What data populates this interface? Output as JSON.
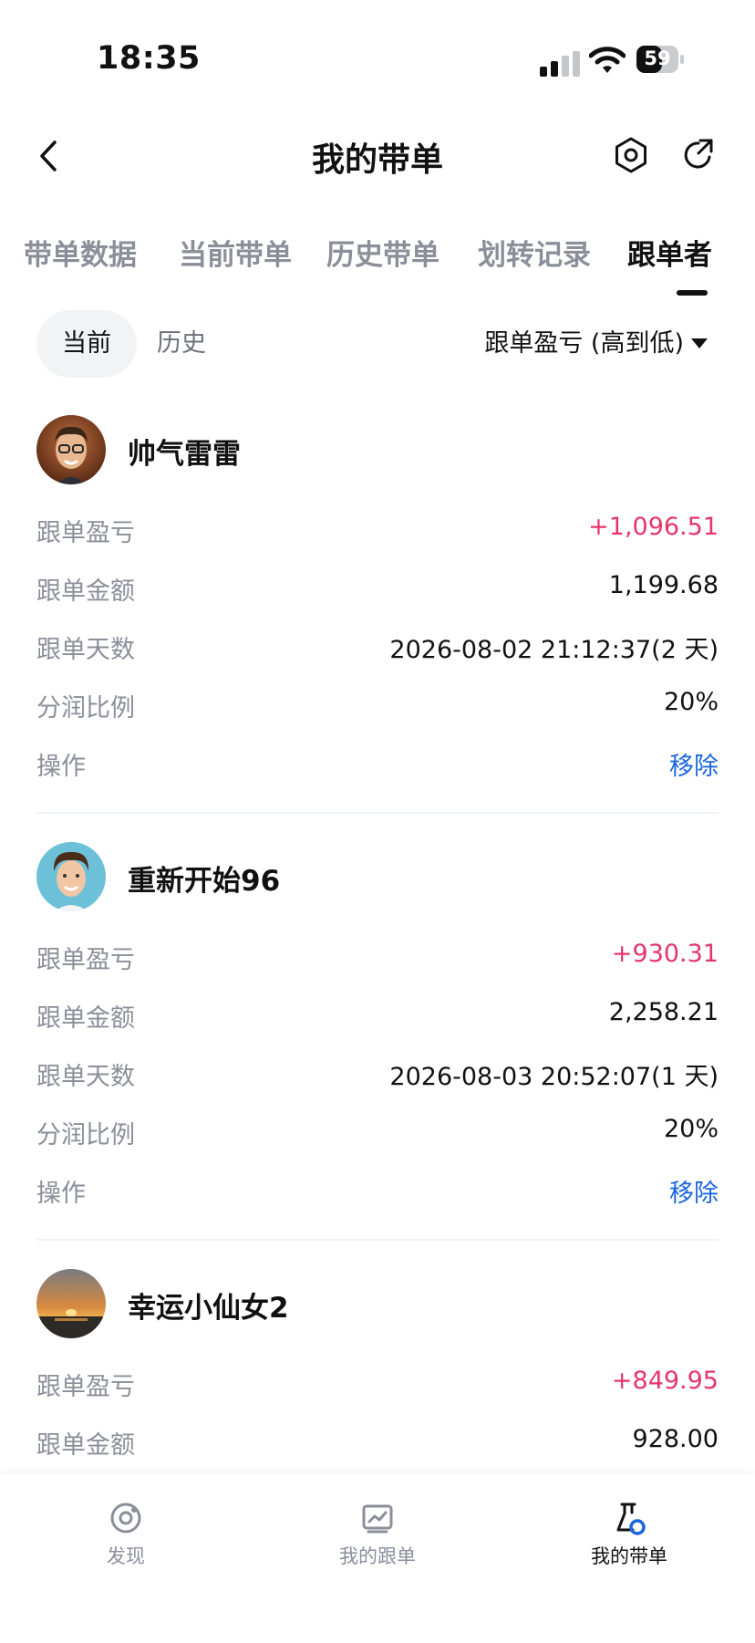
{
  "status_bar": {
    "time": "18:35",
    "battery": "59"
  },
  "header": {
    "title": "我的带单"
  },
  "tabs": [
    {
      "label": "带单数据",
      "active": false
    },
    {
      "label": "当前带单",
      "active": false
    },
    {
      "label": "历史带单",
      "active": false
    },
    {
      "label": "划转记录",
      "active": false
    },
    {
      "label": "跟单者",
      "active": true
    }
  ],
  "filter": {
    "segments": [
      "当前",
      "历史"
    ],
    "selected_segment": "当前",
    "sort_label": "跟单盈亏 (高到低)"
  },
  "row_labels": {
    "profit": "跟单盈亏",
    "amount": "跟单金额",
    "days": "跟单天数",
    "share": "分润比例",
    "action": "操作"
  },
  "followers": [
    {
      "name": "帅气雷雷",
      "profit": "+1,096.51",
      "amount": "1,199.68",
      "days": "2026-08-02 21:12:37(2 天)",
      "share": "20%",
      "action": "移除"
    },
    {
      "name": "重新开始96",
      "profit": "+930.31",
      "amount": "2,258.21",
      "days": "2026-08-03 20:52:07(1 天)",
      "share": "20%",
      "action": "移除"
    },
    {
      "name": "幸运小仙女2",
      "profit": "+849.95",
      "amount": "928.00"
    }
  ],
  "bottom_nav": [
    {
      "label": "发现",
      "icon": "discover-icon",
      "active": false
    },
    {
      "label": "我的跟单",
      "icon": "chart-icon",
      "active": false
    },
    {
      "label": "我的带单",
      "icon": "flask-icon",
      "active": true
    }
  ],
  "colors": {
    "profit": "#e5366b",
    "action": "#1a66e0",
    "muted": "#8a8f99"
  }
}
